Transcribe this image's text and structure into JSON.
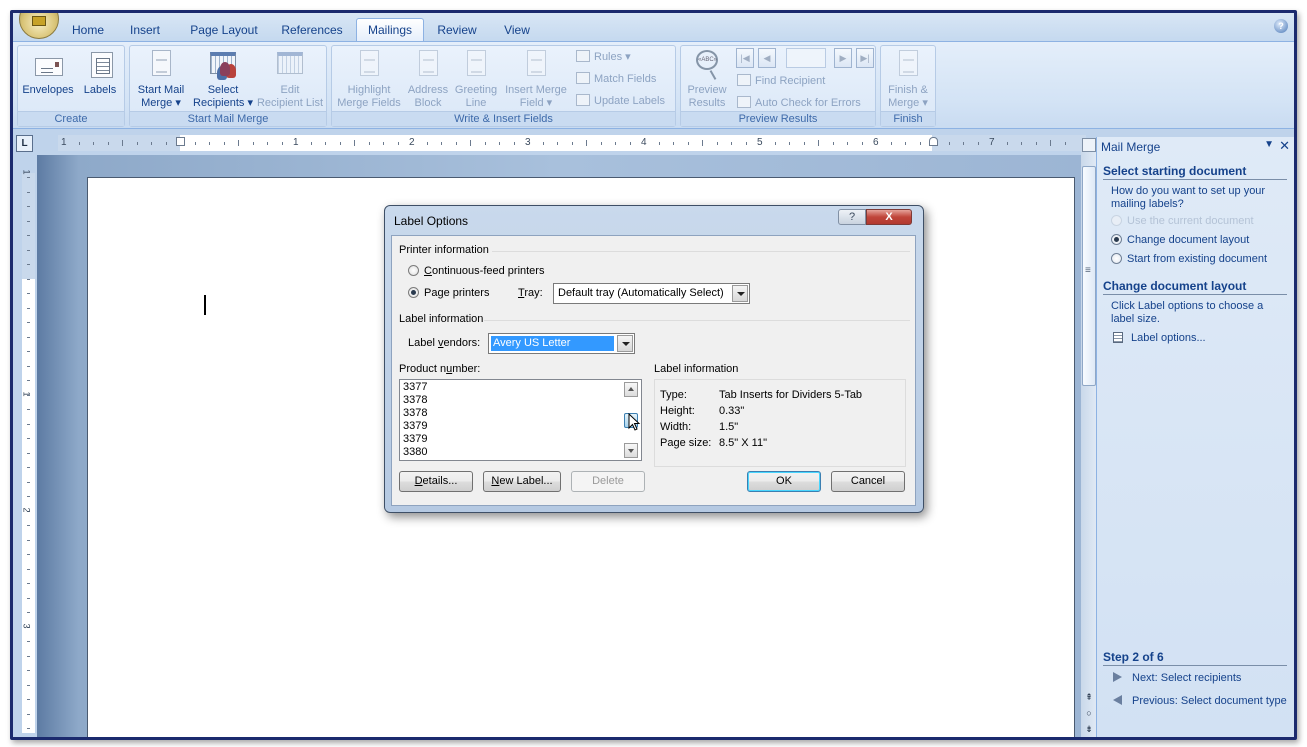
{
  "app": {
    "tabs": [
      {
        "label": "Home",
        "active": false
      },
      {
        "label": "Insert",
        "active": false
      },
      {
        "label": "Page Layout",
        "active": false
      },
      {
        "label": "References",
        "active": false
      },
      {
        "label": "Mailings",
        "active": true
      },
      {
        "label": "Review",
        "active": false
      },
      {
        "label": "View",
        "active": false
      }
    ],
    "help_label": "?"
  },
  "ribbon": {
    "groups": {
      "create": {
        "label": "Create",
        "envelopes": "Envelopes",
        "labels": "Labels"
      },
      "start_mail_merge": {
        "label": "Start Mail Merge",
        "start_mail_merge_l1": "Start Mail",
        "start_mail_merge_l2": "Merge ▾",
        "select_recipients_l1": "Select",
        "select_recipients_l2": "Recipients ▾",
        "edit_recipient_list_l1": "Edit",
        "edit_recipient_list_l2": "Recipient List"
      },
      "write_insert": {
        "label": "Write & Insert Fields",
        "highlight_l1": "Highlight",
        "highlight_l2": "Merge Fields",
        "address_l1": "Address",
        "address_l2": "Block",
        "greeting_l1": "Greeting",
        "greeting_l2": "Line",
        "insert_merge_l1": "Insert Merge",
        "insert_merge_l2": "Field ▾",
        "rules": "Rules ▾",
        "match_fields": "Match Fields",
        "update_labels": "Update Labels"
      },
      "preview": {
        "label": "Preview Results",
        "preview_l1": "Preview",
        "preview_l2": "Results",
        "preview_icon_text": "«ABC»",
        "find_recipient": "Find Recipient",
        "auto_check": "Auto Check for Errors",
        "record_value": ""
      },
      "finish": {
        "label": "Finish",
        "finish_l1": "Finish &",
        "finish_l2": "Merge ▾"
      }
    }
  },
  "ruler": {
    "tab_selector": "L",
    "h_numbers": [
      "1",
      "1",
      "2",
      "3",
      "4",
      "5",
      "6",
      "7"
    ],
    "v_numbers": [
      "1",
      "1",
      "2",
      "3"
    ]
  },
  "task_pane": {
    "title": "Mail Merge",
    "menu_glyph": "▼",
    "close_glyph": "✕",
    "section1_heading": "Select starting document",
    "section1_question": "How do you want to set up your mailing labels?",
    "options": [
      {
        "label": "Use the current document",
        "selected": false,
        "disabled": true
      },
      {
        "label": "Change document layout",
        "selected": true,
        "disabled": false
      },
      {
        "label": "Start from existing document",
        "selected": false,
        "disabled": false
      }
    ],
    "section2_heading": "Change document layout",
    "section2_text": "Click Label options to choose a label size.",
    "label_options_link": "Label options...",
    "step_heading": "Step 2 of 6",
    "next_link": "Next: Select recipients",
    "previous_link": "Previous: Select document type"
  },
  "dialog": {
    "title": "Label Options",
    "help_glyph": "?",
    "close_glyph": "X",
    "printer_info_label": "Printer information",
    "continuous_feed": {
      "pre": "",
      "ul": "C",
      "post": "ontinuous-feed printers",
      "selected": false
    },
    "page_printers": {
      "pre": "Pa",
      "ul": "g",
      "post": "e printers",
      "selected": true
    },
    "tray_label": {
      "pre": "",
      "ul": "T",
      "post": "ray:"
    },
    "tray_value": "Default tray (Automatically Select)",
    "label_info_label": "Label information",
    "vendors_label": {
      "pre": "Label ",
      "ul": "v",
      "post": "endors:"
    },
    "vendors_value": "Avery US Letter",
    "product_number_label": {
      "pre": "Product n",
      "ul": "u",
      "post": "mber:"
    },
    "product_numbers": [
      "3377",
      "3378",
      "3378",
      "3379",
      "3379",
      "3380"
    ],
    "info_box_label": "Label information",
    "info": {
      "type_key": "Type:",
      "type_val": "Tab Inserts for Dividers 5-Tab",
      "height_key": "Height:",
      "height_val": "0.33\"",
      "width_key": "Width:",
      "width_val": "1.5\"",
      "page_key": "Page size:",
      "page_val": "8.5\" X 11\""
    },
    "buttons": {
      "details": {
        "pre": "",
        "ul": "D",
        "post": "etails..."
      },
      "new_label": {
        "pre": "",
        "ul": "N",
        "post": "ew Label..."
      },
      "delete": "Delete",
      "ok": "OK",
      "cancel": "Cancel"
    }
  }
}
